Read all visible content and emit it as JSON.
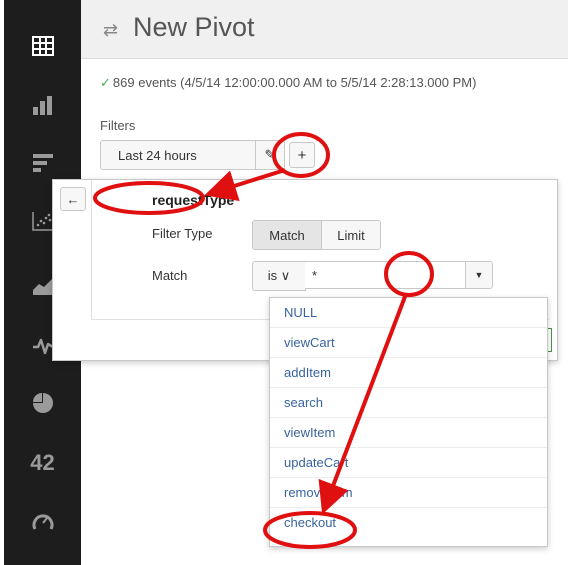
{
  "sidebar": {
    "icons": [
      "table-icon",
      "column-chart-icon",
      "bar-chart-icon",
      "scatter-chart-icon",
      "area-chart-icon",
      "line-chart-icon",
      "pie-chart-icon",
      "single-value-icon",
      "gauge-icon"
    ],
    "single_value_label": "42"
  },
  "header": {
    "title": "New Pivot",
    "icon": "pivot-icon"
  },
  "status": {
    "check": "✓",
    "text": "869 events (4/5/14 12:00:00.000 AM to 5/5/14 2:28:13.000 PM)"
  },
  "filters": {
    "label": "Filters",
    "time_filter": "Last 24 hours",
    "edit_glyph": "✎",
    "add_glyph": "+"
  },
  "popover": {
    "back_glyph": "←",
    "field_name": "requestType",
    "filter_type_label": "Filter Type",
    "filter_type_options": [
      "Match",
      "Limit"
    ],
    "filter_type_selected": "Match",
    "match_label": "Match",
    "operator": "is ∨",
    "match_value": "*",
    "dropdown_glyph": "▼"
  },
  "dropdown": {
    "items": [
      "NULL",
      "viewCart",
      "addItem",
      "search",
      "viewItem",
      "updateCart",
      "removeItem",
      "checkout"
    ]
  },
  "colors": {
    "sidebar_bg": "#1d1d1d",
    "sidebar_icon": "#9a9a9a",
    "link_blue": "#3863a0",
    "annotation_red": "#e01010",
    "status_check": "#4caf50"
  }
}
